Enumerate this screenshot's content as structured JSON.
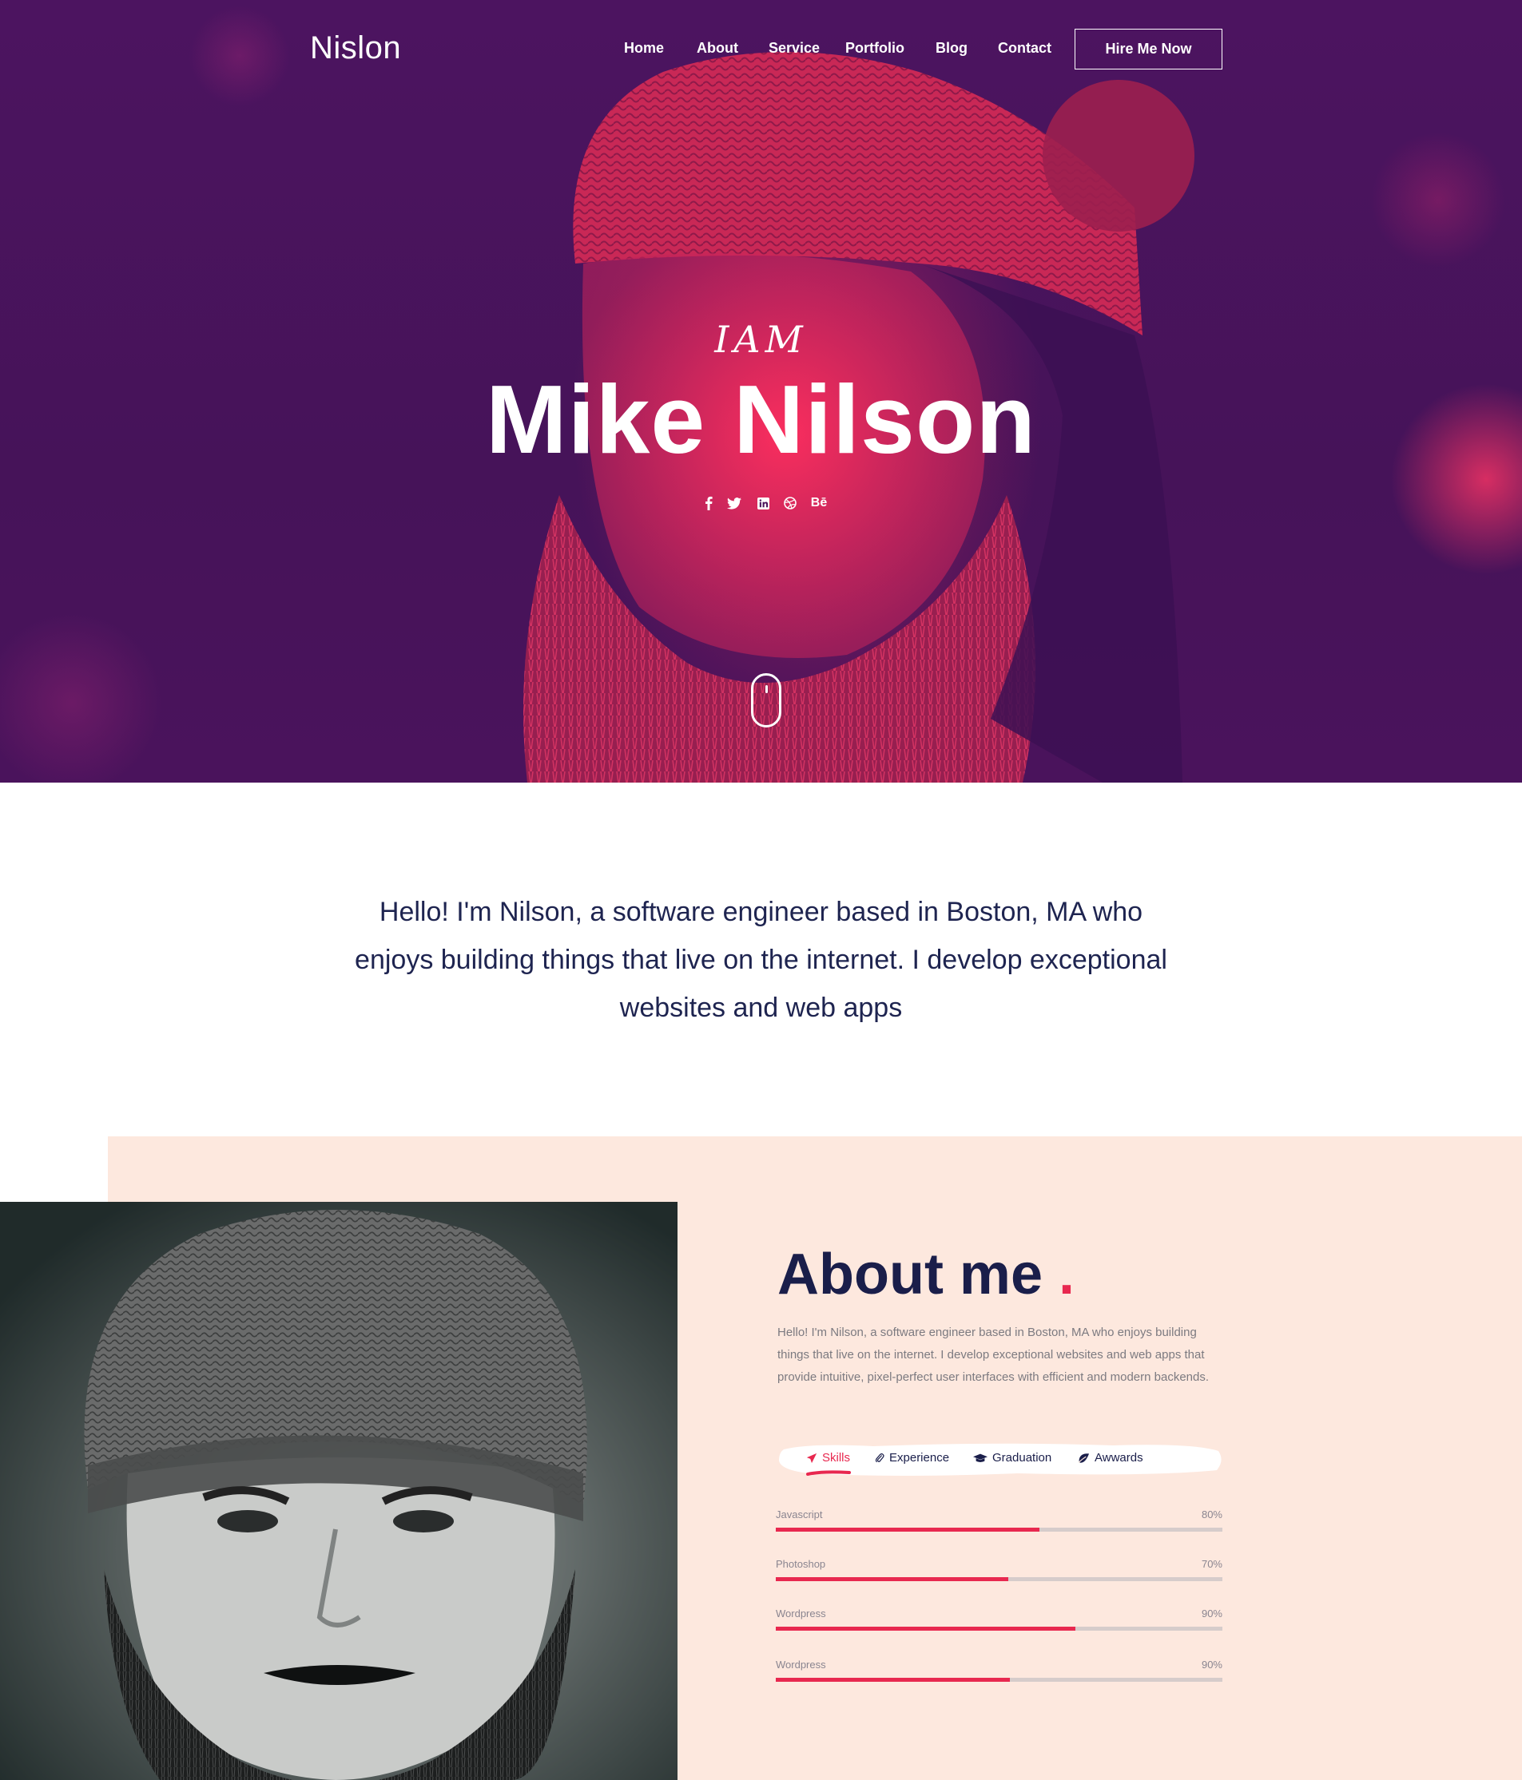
{
  "header": {
    "logo": "Nislon",
    "nav": [
      "Home",
      "About",
      "Service",
      "Portfolio",
      "Blog",
      "Contact"
    ],
    "cta": "Hire Me Now"
  },
  "hero": {
    "eyebrow": "IAM",
    "name": "Mike Nilson",
    "socials": [
      "facebook-icon",
      "twitter-icon",
      "linkedin-icon",
      "dribbble-icon",
      "behance-icon"
    ],
    "behance_label": "Bē"
  },
  "intro": {
    "text": "Hello! I'm Nilson, a software engineer based in Boston, MA who enjoys building things that live on the internet. I develop exceptional websites and web apps"
  },
  "about": {
    "title": "About me",
    "title_dot": ".",
    "text": "Hello! I'm Nilson, a software engineer based in Boston, MA who enjoys building things that live on the internet. I develop exceptional websites and web apps that provide intuitive, pixel-perfect user interfaces with efficient and modern backends.",
    "tabs": [
      {
        "label": "Skills",
        "icon": "rocket-icon",
        "active": true
      },
      {
        "label": "Experience",
        "icon": "paperclip-icon",
        "active": false
      },
      {
        "label": "Graduation",
        "icon": "graduation-cap-icon",
        "active": false
      },
      {
        "label": "Awwards",
        "icon": "leaf-icon",
        "active": false
      }
    ],
    "skills": [
      {
        "name": "Javascript",
        "percent_label": "80%",
        "bar_fill": 0.59
      },
      {
        "name": "Photoshop",
        "percent_label": "70%",
        "bar_fill": 0.52
      },
      {
        "name": "Wordpress",
        "percent_label": "90%",
        "bar_fill": 0.67
      },
      {
        "name": "Wordpress",
        "percent_label": "90%",
        "bar_fill": 0.525
      }
    ]
  },
  "colors": {
    "accent": "#e8284f",
    "hero_purple": "#4a135c",
    "about_bg": "#fde8de",
    "heading": "#1a1e4a"
  }
}
